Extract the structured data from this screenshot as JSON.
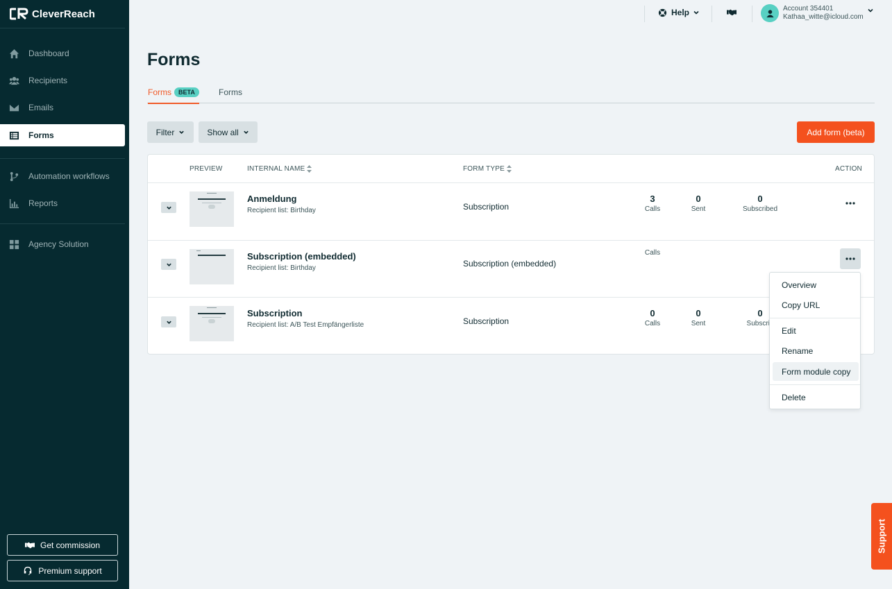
{
  "brand": {
    "name": "CleverReach"
  },
  "sidebar": {
    "items": [
      {
        "label": "Dashboard",
        "icon": "home-icon"
      },
      {
        "label": "Recipients",
        "icon": "users-icon"
      },
      {
        "label": "Emails",
        "icon": "envelope-icon"
      },
      {
        "label": "Forms",
        "icon": "form-list-icon",
        "active": true
      },
      {
        "label": "Automation workflows",
        "icon": "workflow-icon"
      },
      {
        "label": "Reports",
        "icon": "bar-chart-icon"
      },
      {
        "label": "Agency Solution",
        "icon": "grid-icon"
      }
    ],
    "buttons": {
      "commission": "Get commission",
      "premium": "Premium support"
    }
  },
  "topbar": {
    "help": "Help",
    "account_number": "Account 354401",
    "account_email": "Kathaa_witte@icloud.com"
  },
  "page": {
    "title": "Forms",
    "tabs": [
      {
        "label": "Forms",
        "badge": "BETA",
        "active": true
      },
      {
        "label": "Forms"
      }
    ],
    "filter_label": "Filter",
    "showall_label": "Show all",
    "add_label": "Add form (beta)"
  },
  "table": {
    "headers": {
      "preview": "PREVIEW",
      "name": "INTERNAL NAME",
      "type": "FORM TYPE",
      "action": "ACTION"
    },
    "rows": [
      {
        "name": "Anmeldung",
        "sub": "Recipient list: Birthday",
        "type": "Subscription",
        "calls": "3",
        "calls_label": "Calls",
        "sent": "0",
        "sent_label": "Sent",
        "subscribed": "0",
        "subscribed_label": "Subscribed"
      },
      {
        "name": "Subscription (embedded)",
        "sub": "Recipient list: Birthday",
        "type": "Subscription (embedded)",
        "calls_label": "Calls"
      },
      {
        "name": "Subscription",
        "sub": "Recipient list: A/B Test Empfängerliste",
        "type": "Subscription",
        "calls": "0",
        "calls_label": "Calls",
        "sent": "0",
        "sent_label": "Sent",
        "subscribed": "0",
        "subscribed_label": "Subscrib"
      }
    ]
  },
  "menu": {
    "items": [
      "Overview",
      "Copy URL",
      "Edit",
      "Rename",
      "Form module copy",
      "Delete"
    ]
  },
  "support": {
    "label": "Support"
  },
  "colors": {
    "accent": "#f4511e",
    "sidebar": "#062a30",
    "badge": "#58d0c3"
  }
}
